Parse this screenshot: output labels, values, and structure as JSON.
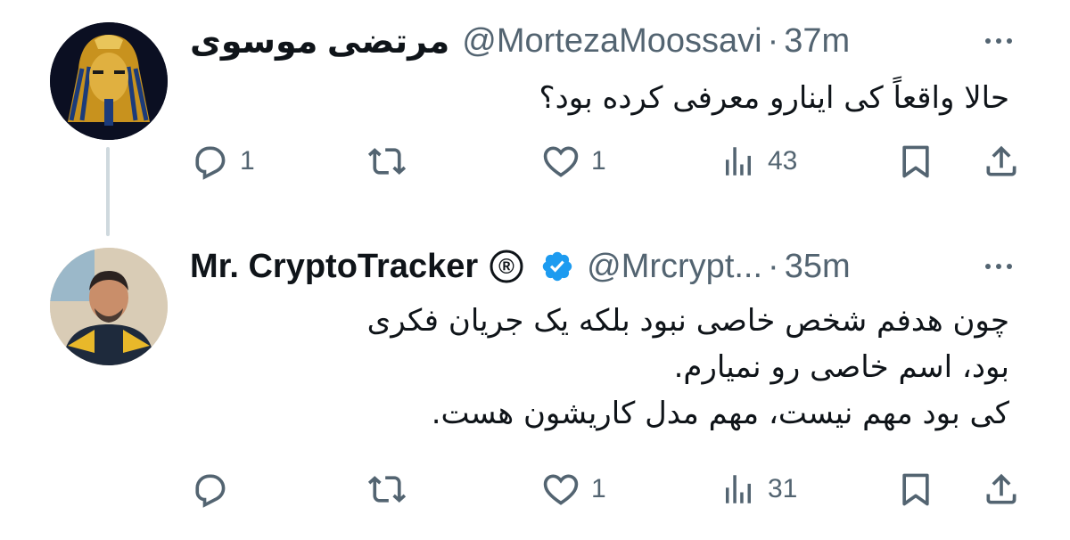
{
  "tweets": [
    {
      "name": "مرتضی موسوی",
      "handle": "@MortezaMoossavi",
      "separator": "·",
      "time": "37m",
      "text": "حالا واقعاً کی اینارو معرفی کرده بود؟",
      "actions": {
        "reply": "1",
        "retweet": "",
        "like": "1",
        "views": "43"
      },
      "avatar_icon": "golden-pharaoh-mask"
    },
    {
      "name": "Mr. CryptoTracker",
      "badge_symbol": "®",
      "handle": "@Mrcrypt...",
      "separator": "·",
      "time": "35m",
      "verified": true,
      "text": "چون هدفم شخص خاصی نبود بلکه یک جریان فکری\nبود، اسم خاصی رو نمیارم.\nکی بود مهم نیست، مهم مدل کاریشون هست.",
      "actions": {
        "reply": "",
        "retweet": "",
        "like": "1",
        "views": "31"
      },
      "avatar_icon": "man-portrait"
    }
  ],
  "colors": {
    "text": "#0f1419",
    "secondary": "#536471",
    "verified": "#1d9bf0",
    "thread_line": "#cfd9de"
  }
}
